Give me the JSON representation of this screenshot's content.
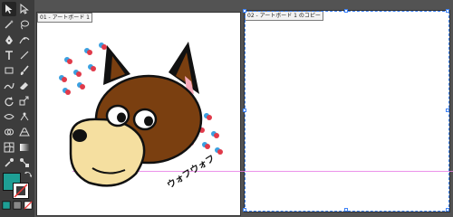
{
  "tools": [
    {
      "name": "selection-tool-icon"
    },
    {
      "name": "direct-selection-tool-icon"
    },
    {
      "name": "magic-wand-tool-icon"
    },
    {
      "name": "lasso-tool-icon"
    },
    {
      "name": "pen-tool-icon"
    },
    {
      "name": "curvature-tool-icon"
    },
    {
      "name": "type-tool-icon"
    },
    {
      "name": "line-tool-icon"
    },
    {
      "name": "rectangle-tool-icon"
    },
    {
      "name": "paintbrush-tool-icon"
    },
    {
      "name": "shaper-tool-icon"
    },
    {
      "name": "eraser-tool-icon"
    },
    {
      "name": "rotate-tool-icon"
    },
    {
      "name": "scale-tool-icon"
    },
    {
      "name": "width-tool-icon"
    },
    {
      "name": "puppet-warp-tool-icon"
    },
    {
      "name": "shape-builder-tool-icon"
    },
    {
      "name": "perspective-grid-tool-icon"
    },
    {
      "name": "mesh-tool-icon"
    },
    {
      "name": "gradient-tool-icon"
    },
    {
      "name": "eyedropper-tool-icon"
    },
    {
      "name": "blend-tool-icon"
    },
    {
      "name": "symbol-sprayer-tool-icon"
    },
    {
      "name": "graph-tool-icon"
    },
    {
      "name": "artboard-tool-icon"
    },
    {
      "name": "slice-tool-icon"
    },
    {
      "name": "hand-tool-icon"
    },
    {
      "name": "zoom-tool-icon"
    }
  ],
  "colors": {
    "fill": "#1e9f95",
    "stroke": "#ffffff",
    "selection": "#3f83f7",
    "guide": "#e77fe6",
    "dog_brown": "#7a3f10",
    "snout": "#f5dfa0",
    "inner_ear": "#f6a9b8",
    "dot_blue": "#3aa0e0",
    "dot_red": "#e03a4a"
  },
  "artboards": [
    {
      "label": "01 - アートボード 1"
    },
    {
      "label": "02 - アートボード 1 のコピー"
    }
  ],
  "artwork": {
    "text": "ウォフウォフ"
  }
}
